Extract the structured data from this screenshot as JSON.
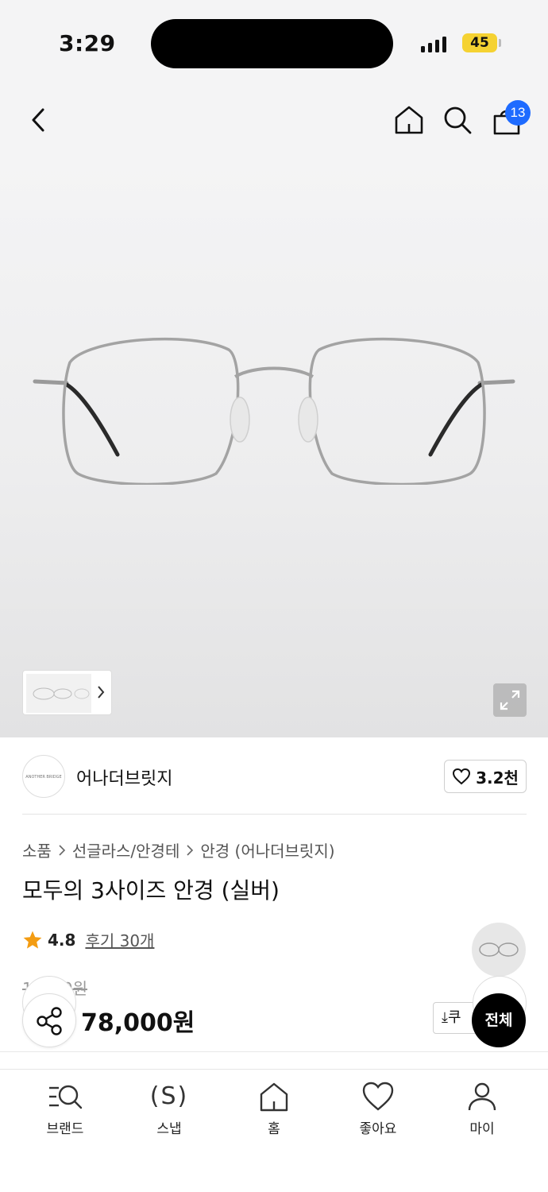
{
  "status_bar": {
    "time": "3:29",
    "battery": "45"
  },
  "top_nav": {
    "cart_count": "13"
  },
  "gallery": {
    "thumbnail_icon": "glasses-thumbnail",
    "expand_icon": "expand-icon"
  },
  "brand": {
    "logo_text": "ANOTHER BRIDGE",
    "name": "어나더브릿지",
    "like_count": "3.2천"
  },
  "breadcrumb": [
    "소품",
    "선글라스/안경테",
    "안경 (어나더브릿지)"
  ],
  "product": {
    "title": "모두의 3사이즈 안경 (실버)",
    "rating": "4.8",
    "review_link": "후기 30개",
    "original_price": "1    00원",
    "price": "78,000원",
    "coupon_label": "쿠"
  },
  "floating": {
    "all_label": "전체"
  },
  "tabs": [
    {
      "label": "브랜드",
      "icon": "brand-search-icon"
    },
    {
      "label": "스냅",
      "icon": "snap-icon",
      "glyph": "(S)"
    },
    {
      "label": "홈",
      "icon": "home-icon"
    },
    {
      "label": "좋아요",
      "icon": "heart-icon"
    },
    {
      "label": "마이",
      "icon": "person-icon"
    }
  ],
  "colors": {
    "badge": "#1e6bff",
    "star": "#f39c12",
    "battery": "#f5d232"
  }
}
